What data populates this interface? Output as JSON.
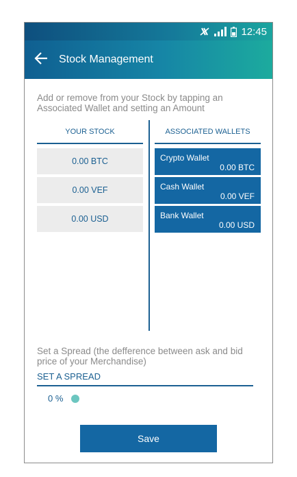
{
  "status_bar": {
    "time": "12:45",
    "icons": [
      "mute-vibrate-icon",
      "signal-icon",
      "battery-icon"
    ]
  },
  "app_bar": {
    "back_icon": "arrow-left-icon",
    "title": "Stock Management"
  },
  "intro_text": "Add or remove from your Stock by tapping an Associated Wallet and setting an Amount",
  "columns": {
    "your_stock": "YOUR STOCK",
    "associated_wallets": "ASSOCIATED WALLETS"
  },
  "stock_items": [
    {
      "value": "0.00 BTC"
    },
    {
      "value": "0.00 VEF"
    },
    {
      "value": "0.00 USD"
    }
  ],
  "wallets": [
    {
      "name": "Crypto Wallet",
      "amount": "0.00 BTC"
    },
    {
      "name": "Cash Wallet",
      "amount": "0.00 VEF"
    },
    {
      "name": "Bank Wallet",
      "amount": "0.00 USD"
    }
  ],
  "spread": {
    "description": "Set a Spread (the defference between ask and bid price of your Merchandise)",
    "link_label": "SET A SPREAD",
    "value": "0 %"
  },
  "save_label": "Save",
  "colors": {
    "primary": "#1467a3",
    "accent": "#1cab9e",
    "slider_thumb": "#6cc6c0"
  }
}
